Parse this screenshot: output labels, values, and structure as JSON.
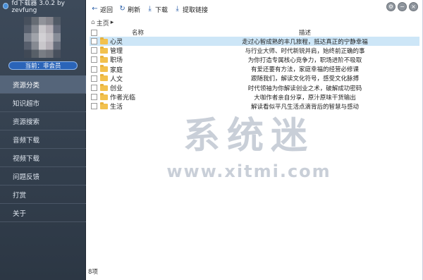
{
  "app": {
    "title": "fd下载器 3.0.2 by zevfung"
  },
  "user": {
    "member_label": "当前：非会员"
  },
  "sidebar": {
    "items": [
      {
        "label": "资源分类",
        "active": true
      },
      {
        "label": "知识超市"
      },
      {
        "label": "资源搜索"
      },
      {
        "label": "音频下载"
      },
      {
        "label": "视频下载"
      },
      {
        "label": "问题反馈"
      },
      {
        "label": "打赏"
      },
      {
        "label": "关于"
      }
    ]
  },
  "toolbar": {
    "back_label": "返回",
    "refresh_label": "刷新",
    "download_label": "下载",
    "extract_label": "提取链接"
  },
  "breadcrumb": {
    "home_label": "主页"
  },
  "table": {
    "headers": {
      "name": "名称",
      "desc": "描述"
    },
    "rows": [
      {
        "name": "心灵",
        "desc": "走过心智成熟的丰几旅程，抵达真正的宁静幸福",
        "selected": true
      },
      {
        "name": "管理",
        "desc": "与行业大师、时代新锐并肩，始终前正确的事"
      },
      {
        "name": "职场",
        "desc": "为你打造专属核心竞争力，职场进阶不吸取"
      },
      {
        "name": "家庭",
        "desc": "有爱还要有方法，家庭幸福的经营必修课"
      },
      {
        "name": "人文",
        "desc": "跟随我们，解读文化符号，感受文化脉搏"
      },
      {
        "name": "创业",
        "desc": "时代领袖为你解读创业之术，破解成功密码"
      },
      {
        "name": "作者光临",
        "desc": "大咖作者亲自分享，原汁原味干货输出"
      },
      {
        "name": "生活",
        "desc": "解读看似平凡生活点滴背后的智慧与感动"
      }
    ]
  },
  "status": {
    "text": "8项"
  },
  "watermark": {
    "title": "系统迷",
    "url": "www.xitmi.com"
  },
  "icons": {
    "back": "arrow-left-icon",
    "refresh": "refresh-icon",
    "download": "download-icon",
    "extract": "extract-link-icon"
  },
  "colors": {
    "sidebar": "#2c3744",
    "selected_row": "#cde6f7",
    "badge": "#2a64b8",
    "folder": "#f2c14e"
  }
}
